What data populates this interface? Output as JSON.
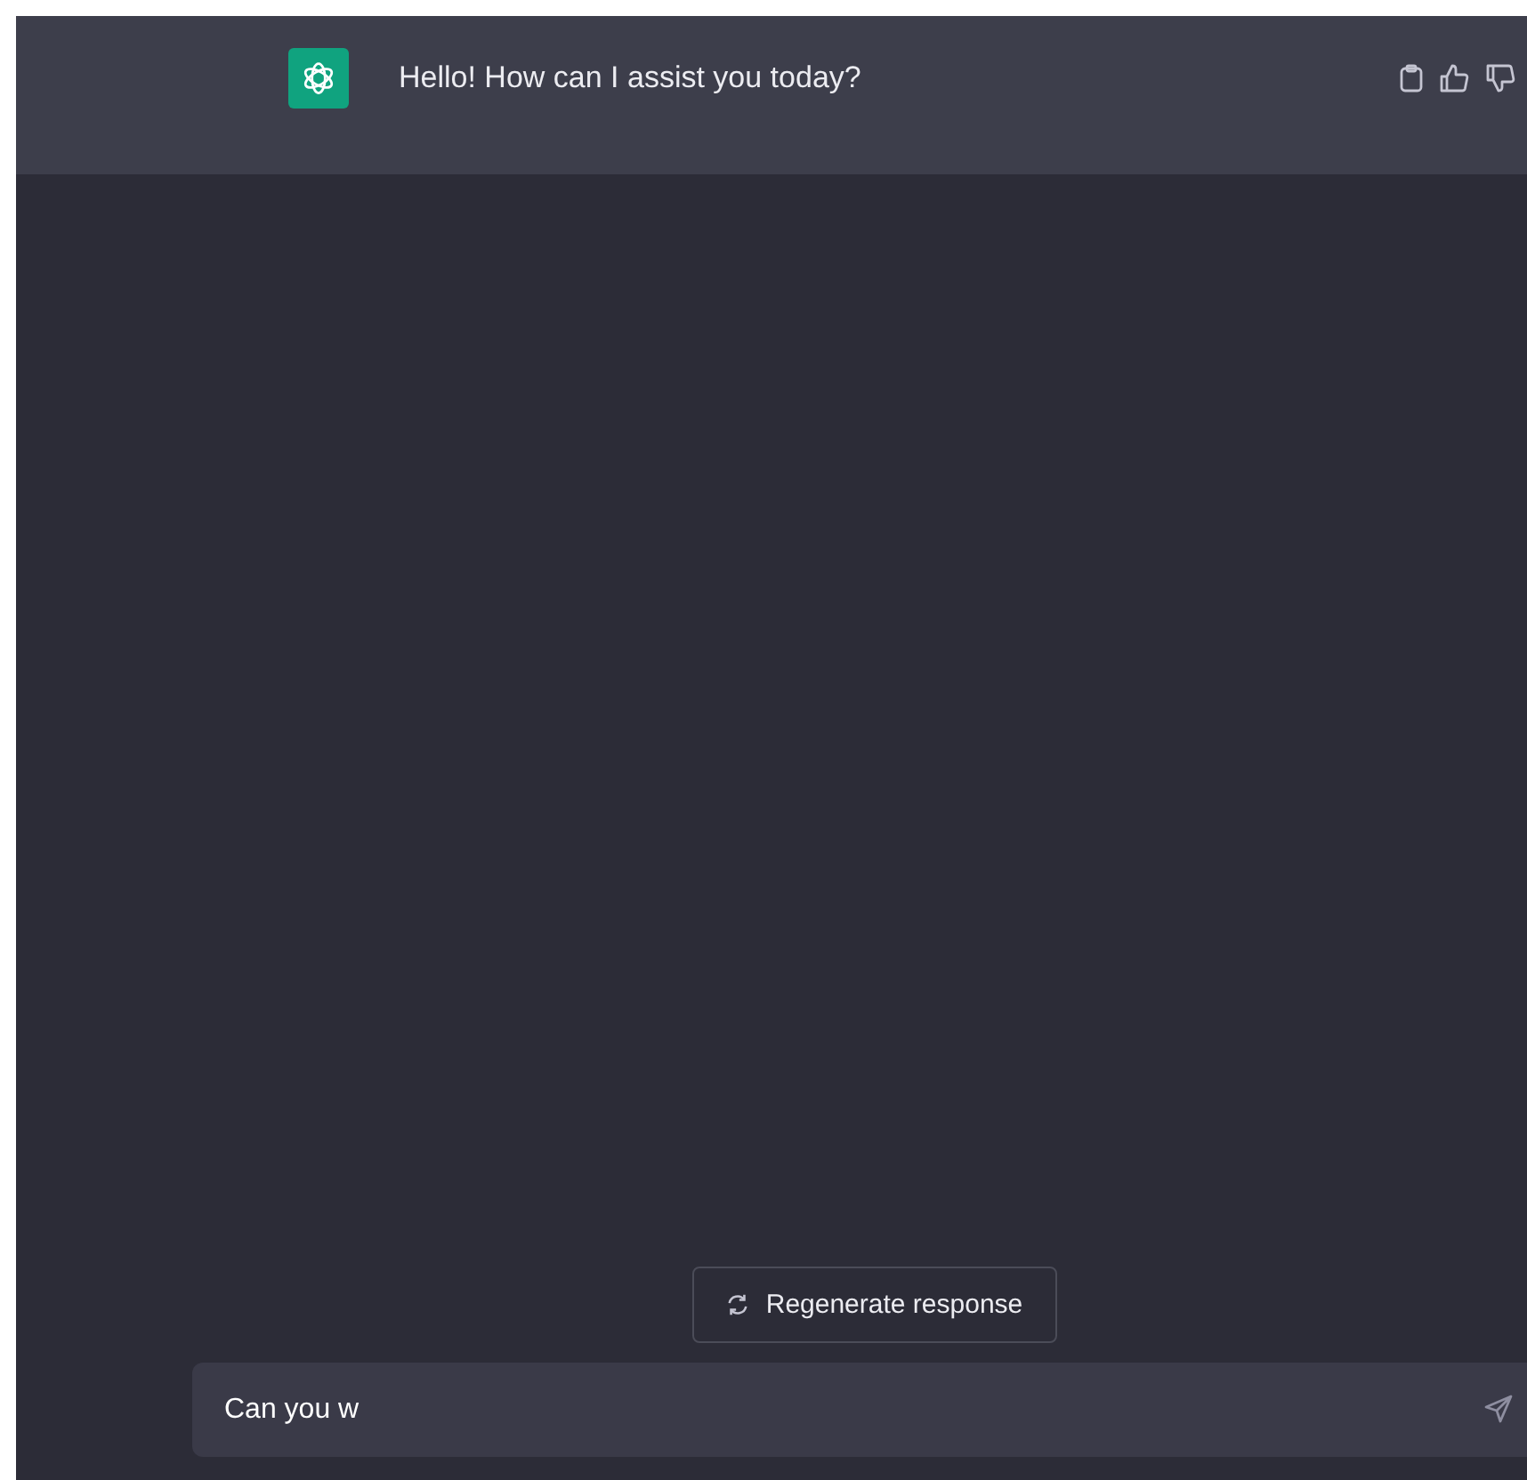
{
  "message": {
    "text": "Hello! How can I assist you today?"
  },
  "regenerate_button": {
    "label": "Regenerate response"
  },
  "composer": {
    "value": "Can you w"
  }
}
